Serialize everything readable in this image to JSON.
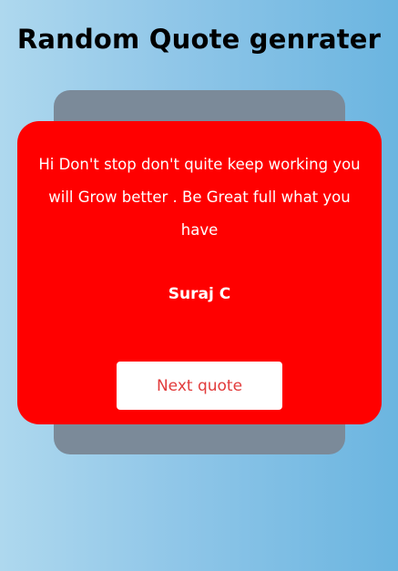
{
  "header": {
    "title": "Random Quote genrater"
  },
  "quote": {
    "text": "Hi Don't stop don't quite keep working you will Grow better . Be Great full what you have",
    "author": "Suraj C"
  },
  "actions": {
    "next_label": "Next quote"
  },
  "colors": {
    "card_background": "#ff0000",
    "back_card": "#7b8a99",
    "button_text": "#e23b3b",
    "gradient_start": "#aed8ee",
    "gradient_end": "#6bb5e0"
  }
}
